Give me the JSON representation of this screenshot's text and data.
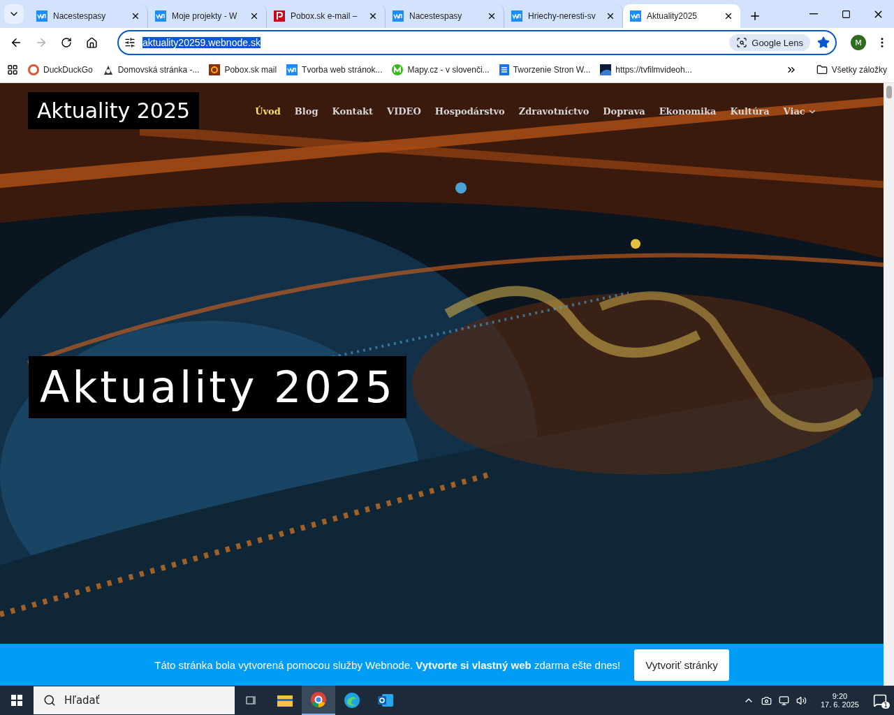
{
  "browser": {
    "tabs": [
      {
        "title": "Nacestespasy",
        "selected": false
      },
      {
        "title": "Moje projekty - W",
        "selected": false
      },
      {
        "title": "Pobox.sk e-mail –",
        "selected": false
      },
      {
        "title": "Nacestespasy",
        "selected": false
      },
      {
        "title": "Hriechy-neresti-sv",
        "selected": false
      },
      {
        "title": "Aktuality2025",
        "selected": true
      }
    ],
    "address": "aktuality20259.webnode.sk",
    "lens_label": "Google Lens",
    "bookmarked": true,
    "profile_initial": "M",
    "bookmarks": [
      {
        "label": "DuckDuckGo"
      },
      {
        "label": "Domovská stránka -..."
      },
      {
        "label": "Pobox.sk mail"
      },
      {
        "label": "Tvorba web stránok..."
      },
      {
        "label": "Mapy.cz - v slovenči..."
      },
      {
        "label": "Tworzenie Stron W..."
      },
      {
        "label": "https://tvfilmvideoh..."
      }
    ],
    "all_bookmarks": "Všetky záložky"
  },
  "site": {
    "logo": "Aktuality 2025",
    "nav": [
      {
        "label": "Úvod",
        "selected": true
      },
      {
        "label": "Blog",
        "selected": false
      },
      {
        "label": "Kontakt",
        "selected": false
      },
      {
        "label": "VIDEO",
        "selected": false
      },
      {
        "label": "Hospodárstvo",
        "selected": false
      },
      {
        "label": "Zdravotníctvo",
        "selected": false
      },
      {
        "label": "Doprava",
        "selected": false
      },
      {
        "label": "Ekonomika",
        "selected": false
      },
      {
        "label": "Kultúra",
        "selected": false
      },
      {
        "label": "Viac",
        "selected": false
      }
    ],
    "hero_title": "Aktuality 2025",
    "banner": {
      "text": "Táto stránka bola vytvorená pomocou služby Webnode. **Vytvorte si vlastný web** zdarma ešte dnes!",
      "button": "Vytvoriť stránky"
    }
  },
  "taskbar": {
    "search_placeholder": "Hľadať",
    "time": "9:20",
    "date": "17. 6. 2025",
    "notifications": "1"
  }
}
